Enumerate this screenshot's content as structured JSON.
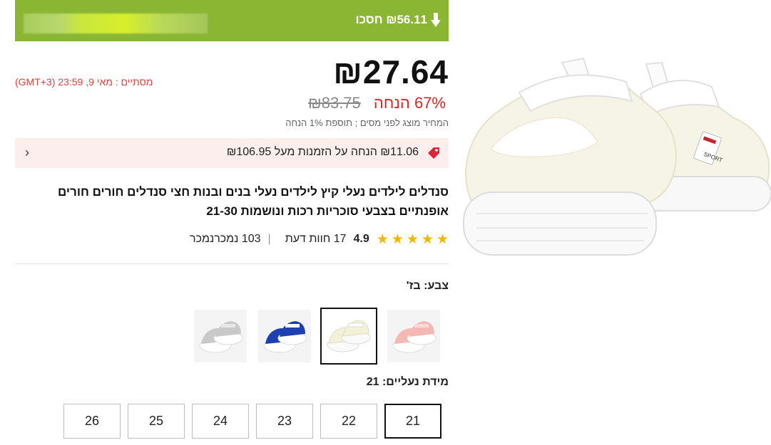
{
  "banner": {
    "savings_text": "₪56.11 חסכו",
    "color": "#8bb634"
  },
  "price": {
    "current": "₪27.64",
    "countdown": "מסתיים :  מאי 9, 23:59 (GMT+3)",
    "original": "₪83.75",
    "discount": "67% הנחה",
    "tax_note": "המחיר מוצג לפני מסים ; תוספת 1% הנחה"
  },
  "coupon": {
    "text": "₪11.06 הנחה על הזמנות מעל ₪106.95",
    "chevron": "›",
    "icon": "tag-icon"
  },
  "product": {
    "title": "סנדלים לילדים נעלי קיץ לילדים נעלי בנים ובנות חצי סנדלים חורים חורים אופנתיים בצבעי סוכריות רכות ונושמות 21-30"
  },
  "rating": {
    "stars": 5,
    "score": "4.9",
    "reviews": "17 חוות דעת",
    "separator": "|",
    "sold": "103 נמכרנמכר"
  },
  "color_selector": {
    "label": "צבע: בז'",
    "options": [
      {
        "name": "pink",
        "color": "#f5b8b4",
        "selected": false
      },
      {
        "name": "beige",
        "color": "#f3f1d8",
        "selected": true
      },
      {
        "name": "blue",
        "color": "#1d3fb0",
        "selected": false
      },
      {
        "name": "grey",
        "color": "#c9c9c9",
        "selected": false
      }
    ]
  },
  "size_selector": {
    "label": "מידת נעליים: 21",
    "options": [
      "21",
      "22",
      "23",
      "24",
      "25",
      "26"
    ],
    "selected": "21"
  },
  "accent_colors": {
    "sale_red": "#e02424",
    "countdown_red": "#e2413e",
    "star": "#f7b500"
  }
}
